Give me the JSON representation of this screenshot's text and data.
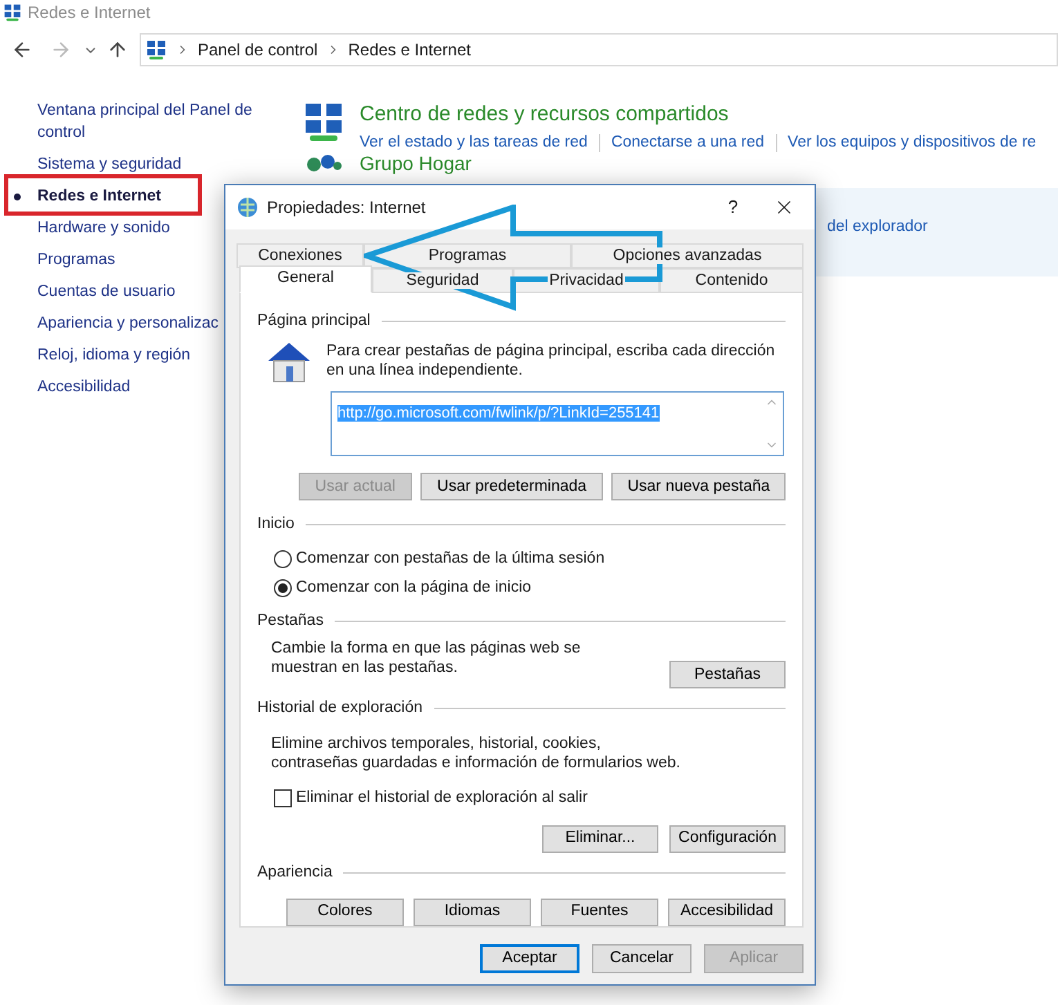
{
  "window": {
    "title": "Redes e Internet"
  },
  "address_bar": {
    "breadcrumb": [
      "Panel de control",
      "Redes e Internet"
    ]
  },
  "sidebar": {
    "items": [
      {
        "label": "Ventana principal del Panel de control",
        "selected": false
      },
      {
        "label": "Sistema y seguridad",
        "selected": false
      },
      {
        "label": "Redes e Internet",
        "selected": true
      },
      {
        "label": "Hardware y sonido",
        "selected": false
      },
      {
        "label": "Programas",
        "selected": false
      },
      {
        "label": "Cuentas de usuario",
        "selected": false
      },
      {
        "label": "Apariencia y personalizac",
        "selected": false
      },
      {
        "label": "Reloj, idioma y región",
        "selected": false
      },
      {
        "label": "Accesibilidad",
        "selected": false
      }
    ]
  },
  "categories": [
    {
      "kind": "network",
      "title": "Centro de redes y recursos compartidos",
      "links": [
        "Ver el estado y las tareas de red",
        "Conectarse a una red",
        "Ver los equipos y dispositivos de re"
      ]
    },
    {
      "kind": "homegroup",
      "title": "Grupo Hogar"
    },
    {
      "kind": "options",
      "links": [
        "del explorador"
      ]
    }
  ],
  "dialog": {
    "title": "Propiedades: Internet",
    "help": "?",
    "tab_rows": [
      {
        "tabs": [
          {
            "label": "Conexiones",
            "selected": false
          },
          {
            "label": "Programas",
            "selected": false
          },
          {
            "label": "Opciones avanzadas",
            "selected": false
          }
        ]
      },
      {
        "tabs": [
          {
            "label": "General",
            "selected": true
          },
          {
            "label": "Seguridad",
            "selected": false
          },
          {
            "label": "Privacidad",
            "selected": false
          },
          {
            "label": "Contenido",
            "selected": false
          }
        ]
      }
    ],
    "home_page": {
      "heading": "Página principal",
      "hint": "Para crear pestañas de página principal, escriba cada dirección en una línea independiente.",
      "url": "http://go.microsoft.com/fwlink/p/?LinkId=255141",
      "buttons": [
        {
          "label": "Usar actual",
          "disabled": true
        },
        {
          "label": "Usar predeterminada",
          "disabled": false
        },
        {
          "label": "Usar nueva pestaña",
          "disabled": false
        }
      ]
    },
    "startup": {
      "heading": "Inicio",
      "options": [
        {
          "label": "Comenzar con pestañas de la última sesión",
          "selected": false
        },
        {
          "label": "Comenzar con la página de inicio",
          "selected": true
        }
      ]
    },
    "tabs_section": {
      "heading": "Pestañas",
      "text": "Cambie la forma en que las páginas web se muestran en las pestañas.",
      "button": "Pestañas"
    },
    "history": {
      "heading": "Historial de exploración",
      "text": "Elimine archivos temporales, historial, cookies, contraseñas guardadas e información de formularios web.",
      "checkbox": {
        "label": "Eliminar el historial de exploración al salir",
        "checked": false
      },
      "buttons": [
        "Eliminar...",
        "Configuración"
      ]
    },
    "appearance": {
      "heading": "Apariencia",
      "buttons": [
        "Colores",
        "Idiomas",
        "Fuentes",
        "Accesibilidad"
      ]
    },
    "footer_buttons": [
      {
        "label": "Aceptar",
        "default": true,
        "disabled": false
      },
      {
        "label": "Cancelar",
        "default": false,
        "disabled": false
      },
      {
        "label": "Aplicar",
        "default": false,
        "disabled": true
      }
    ]
  }
}
